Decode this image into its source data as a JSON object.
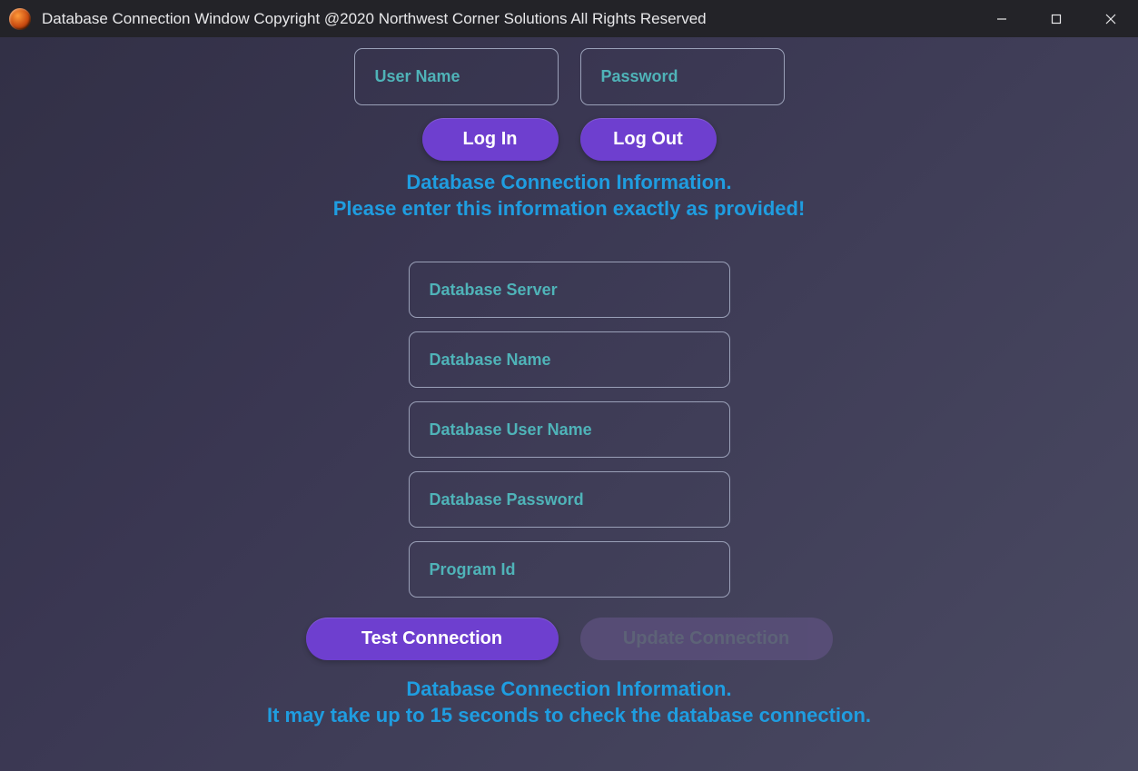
{
  "window": {
    "title": "Database Connection Window Copyright @2020 Northwest Corner Solutions All Rights Reserved"
  },
  "auth": {
    "username_placeholder": "User Name",
    "password_placeholder": "Password",
    "login_label": "Log In",
    "logout_label": "Log Out"
  },
  "heading1": {
    "line1": "Database Connection Information.",
    "line2": "Please enter this information exactly as provided!"
  },
  "db": {
    "server_placeholder": "Database Server",
    "name_placeholder": "Database Name",
    "user_placeholder": "Database User Name",
    "password_placeholder": "Database Password",
    "program_id_placeholder": "Program Id"
  },
  "actions": {
    "test_label": "Test Connection",
    "update_label": "Update Connection"
  },
  "heading2": {
    "line1": "Database Connection Information.",
    "line2": "It may take up to 15 seconds to check the database connection."
  }
}
